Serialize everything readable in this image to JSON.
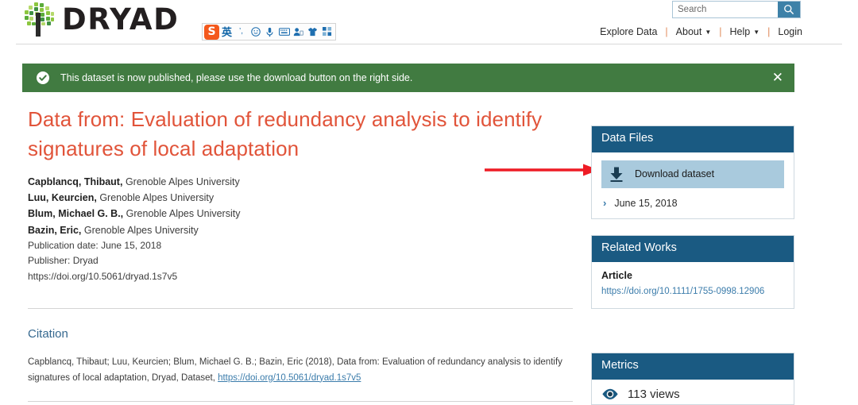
{
  "header": {
    "brand": "DRYAD",
    "logo_icon": "tree-logo-icon",
    "search": {
      "placeholder": "Search",
      "value": "",
      "icon": "search-icon"
    },
    "nav": [
      {
        "label": "Explore Data",
        "has_caret": false
      },
      {
        "label": "About",
        "has_caret": true
      },
      {
        "label": "Help",
        "has_caret": true
      },
      {
        "label": "Login",
        "has_caret": false
      }
    ],
    "nav_separator": "|",
    "caret_glyph": "▼"
  },
  "ime_toolbar": {
    "logo_label": "S",
    "icons": [
      {
        "name": "sogou-logo-icon",
        "glyph": "S"
      },
      {
        "name": "english-mode-icon",
        "glyph": "英"
      },
      {
        "name": "punctuation-mode-icon",
        "glyph": "’,"
      },
      {
        "name": "emoji-icon",
        "glyph": "☺"
      },
      {
        "name": "voice-input-icon",
        "glyph": "mic"
      },
      {
        "name": "soft-keyboard-icon",
        "glyph": "keyboard"
      },
      {
        "name": "user-account-icon",
        "glyph": "user"
      },
      {
        "name": "skin-theme-icon",
        "glyph": "shirt"
      },
      {
        "name": "toolbox-icon",
        "glyph": "grid"
      }
    ]
  },
  "banner": {
    "icon": "check-circle-icon",
    "message": "This dataset is now published, please use the download button on the right side.",
    "close_label": "✕",
    "color": "#417b41"
  },
  "dataset": {
    "title": "Data from: Evaluation of redundancy analysis to identify signatures of local adaptation",
    "title_color": "#e1543a",
    "authors": [
      {
        "name": "Capblancq, Thibaut,",
        "affiliation": "Grenoble Alpes University"
      },
      {
        "name": "Luu, Keurcien,",
        "affiliation": "Grenoble Alpes University"
      },
      {
        "name": "Blum, Michael G. B.,",
        "affiliation": "Grenoble Alpes University"
      },
      {
        "name": "Bazin, Eric,",
        "affiliation": "Grenoble Alpes University"
      }
    ],
    "publication_date": "Publication date: June 15, 2018",
    "publisher": "Publisher: Dryad",
    "doi": "https://doi.org/10.5061/dryad.1s7v5"
  },
  "citation": {
    "heading": "Citation",
    "text_before_link": "Capblancq, Thibaut; Luu, Keurcien; Blum, Michael G. B.; Bazin, Eric (2018), Data from: Evaluation of redundancy analysis to identify signatures of local adaptation, Dryad, Dataset, ",
    "link": "https://doi.org/10.5061/dryad.1s7v5"
  },
  "data_files": {
    "heading": "Data Files",
    "download_label": "Download dataset",
    "download_icon": "download-icon",
    "version_date": "June 15, 2018",
    "version_chevron": "›"
  },
  "related_works": {
    "heading": "Related Works",
    "type": "Article",
    "link": "https://doi.org/10.1111/1755-0998.12906"
  },
  "metrics": {
    "heading": "Metrics",
    "views": "113 views",
    "views_icon": "eye-icon"
  },
  "annotation": {
    "arrow": "red-arrow-pointing-right",
    "color": "#ee1c25"
  },
  "colors": {
    "panel_header": "#1a5a82",
    "download_button": "#a9cadd",
    "link": "#3b7cab",
    "banner_green": "#417b41"
  }
}
